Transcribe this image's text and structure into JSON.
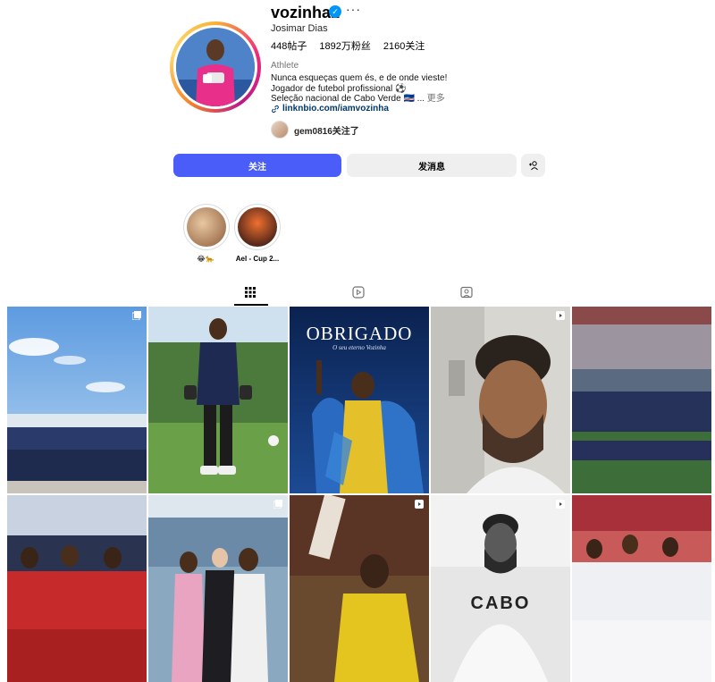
{
  "profile": {
    "username": "vozinha1",
    "full_name": "Josimar Dias",
    "stats": {
      "posts": "448帖子",
      "followers": "1892万粉丝",
      "following": "2160关注"
    },
    "category": "Athlete",
    "bio_lines": [
      "Nunca esqueças quem és, e de onde vieste!",
      "Jogador de futebol profissional ⚽",
      "Seleção nacional de Cabo Verde 🇨🇻 ..."
    ],
    "bio_more": "更多",
    "link": "linknbio.com/iamvozinha",
    "followed_by": "gem0816关注了"
  },
  "buttons": {
    "follow": "关注",
    "message": "发消息"
  },
  "highlights": [
    {
      "label": "😂🐆",
      "colors": [
        "#caa07a",
        "#8d5a3a"
      ]
    },
    {
      "label": "Ael - Cup 2...",
      "colors": [
        "#e0552a",
        "#3a2a24"
      ]
    }
  ],
  "tabs": [
    {
      "name": "posts",
      "icon": "grid-icon",
      "active": true
    },
    {
      "name": "reels",
      "icon": "reels-icon",
      "active": false
    },
    {
      "name": "tagged",
      "icon": "tagged-icon",
      "active": false
    }
  ],
  "grid_posts": [
    {
      "kind": "team-photo-sky",
      "badge": "carousel-icon"
    },
    {
      "kind": "goalkeeper-training",
      "badge": "none"
    },
    {
      "kind": "obrigado-poster",
      "badge": "none",
      "poster_title": "OBRIGADO",
      "poster_sub": "O seu eterno Vozinha"
    },
    {
      "kind": "selfie-video",
      "badge": "reel-icon"
    },
    {
      "kind": "team-lineup-stadium",
      "badge": "none"
    },
    {
      "kind": "team-red-kit",
      "badge": "none"
    },
    {
      "kind": "stadium-group",
      "badge": "carousel-icon"
    },
    {
      "kind": "yellow-kit-match",
      "badge": "reel-icon"
    },
    {
      "kind": "bw-portrait",
      "badge": "reel-icon",
      "shirt_text": "CABO"
    },
    {
      "kind": "white-kit-group",
      "badge": "none"
    }
  ],
  "colors": {
    "follow_button": "#4a5df9",
    "link": "#00376b",
    "verified": "#0095f6"
  }
}
